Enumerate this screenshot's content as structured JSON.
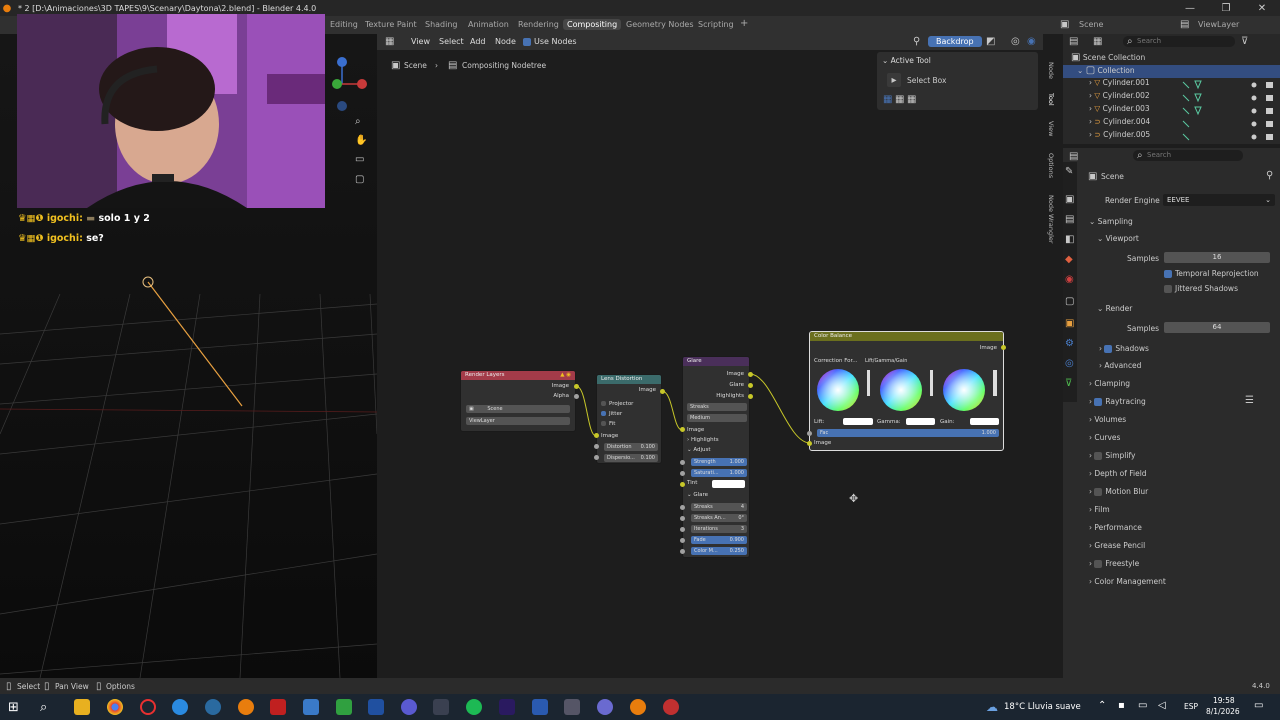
{
  "window": {
    "title": "* 2 [D:\\Animaciones\\3D TAPES\\9\\Scenary\\Daytona\\2.blend] - Blender 4.4.0",
    "controls": [
      "—",
      "❐",
      "✕"
    ]
  },
  "menubar": {
    "left_label": "Ca",
    "workspaces": [
      {
        "label": "Editing",
        "active": false
      },
      {
        "label": "Texture Paint",
        "active": false
      },
      {
        "label": "Shading",
        "active": false
      },
      {
        "label": "Animation",
        "active": false
      },
      {
        "label": "Rendering",
        "active": false
      },
      {
        "label": "Compositing",
        "active": true
      },
      {
        "label": "Geometry Nodes",
        "active": false
      },
      {
        "label": "Scripting",
        "active": false
      }
    ],
    "add_workspace": "+",
    "scene": "Scene",
    "view_layer": "ViewLayer"
  },
  "chat": [
    {
      "user": "igochi:",
      "message": "solo 1 y 2"
    },
    {
      "user": "igochi:",
      "message": "se?"
    }
  ],
  "node_editor": {
    "menus": [
      "View",
      "Select",
      "Add",
      "Node"
    ],
    "use_nodes_label": "Use Nodes",
    "backdrop_label": "Backdrop",
    "breadcrumb": [
      "Scene",
      "Compositing Nodetree"
    ],
    "active_tool": {
      "title": "Active Tool",
      "tool": "Select Box"
    },
    "side_tabs": [
      "Node",
      "Tool",
      "View",
      "Options",
      "Node Wrangler"
    ],
    "nodes": {
      "render_layers": {
        "title": "Render Layers",
        "outputs": [
          "Image",
          "Alpha"
        ],
        "scene": "Scene",
        "view_layer": "ViewLayer"
      },
      "lens_distortion": {
        "title": "Lens Distortion",
        "output": "Image",
        "options": [
          "Projector",
          "Jitter",
          "Fit"
        ],
        "input": "Image",
        "distortion_label": "Distortion",
        "distortion": "0.100",
        "dispersion_label": "Dispersio...",
        "dispersion": "0.100"
      },
      "glare": {
        "title": "Glare",
        "outputs": [
          "Image",
          "Glare",
          "Highlights"
        ],
        "type": "Streaks",
        "quality": "Medium",
        "input": "Image",
        "highlights_panel": "Highlights",
        "adjust_panel": "Adjust",
        "strength_label": "Strength",
        "strength": "1.000",
        "saturation_label": "Saturati...",
        "saturation": "1.000",
        "tint_label": "Tint",
        "glare_panel": "Glare",
        "streaks_label": "Streaks",
        "streaks": "4",
        "streaks_angle_label": "Streaks An...",
        "streaks_angle": "0°",
        "iterations_label": "Iterations",
        "iterations": "3",
        "fade_label": "Fade",
        "fade": "0.900",
        "color_mod_label": "Color M...",
        "color_mod": "0.250"
      },
      "color_balance": {
        "title": "Color Balance",
        "output": "Image",
        "correction_label": "Correction For...",
        "correction_value": "Lift/Gamma/Gain",
        "wheels": [
          "Lift:",
          "Gamma:",
          "Gain:"
        ],
        "fac_label": "Fac",
        "fac": "1.000",
        "input": "Image"
      }
    }
  },
  "outliner": {
    "search_placeholder": "Search",
    "root": "Scene Collection",
    "collection": "Collection",
    "items": [
      "Cylinder.001",
      "Cylinder.002",
      "Cylinder.003",
      "Cylinder.004",
      "Cylinder.005"
    ]
  },
  "properties": {
    "search_placeholder": "Search",
    "context": "Scene",
    "render_engine_label": "Render Engine",
    "render_engine": "EEVEE",
    "sampling": "Sampling",
    "viewport": "Viewport",
    "viewport_samples_label": "Samples",
    "viewport_samples": "16",
    "temporal_reprojection": "Temporal Reprojection",
    "jittered_shadows": "Jittered Shadows",
    "render": "Render",
    "render_samples_label": "Samples",
    "render_samples": "64",
    "shadows": "Shadows",
    "advanced": "Advanced",
    "panels": [
      "Clamping",
      "Raytracing",
      "Volumes",
      "Curves",
      "Simplify",
      "Depth of Field",
      "Motion Blur",
      "Film",
      "Performance",
      "Grease Pencil",
      "Freestyle",
      "Color Management"
    ]
  },
  "statusbar": {
    "items": [
      "Select",
      "Pan View",
      "Options"
    ],
    "version": "4.4.0"
  },
  "taskbar": {
    "weather": "18°C  Lluvia suave",
    "language": "ESP",
    "time": "19:58",
    "date": "8/1/2026"
  },
  "colors": {
    "accent": "#4772b3",
    "render_layers_header": "#a33b49",
    "lens_header": "#3b6b6b",
    "glare_header": "#4a2f5a",
    "color_balance_header": "#6b6f1e",
    "socket_yellow": "#c7c729",
    "socket_grey": "#a1a1a1"
  }
}
